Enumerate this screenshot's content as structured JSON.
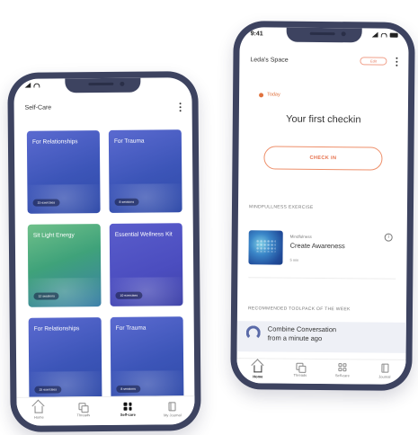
{
  "left_phone": {
    "header": {
      "title": "Self-Care"
    },
    "cards": [
      {
        "title": "For Relationships",
        "badge": "15 exercises",
        "style": "blue"
      },
      {
        "title": "For Trauma",
        "badge": "8 sessions",
        "style": "blue"
      },
      {
        "title": "Sit Light Energy",
        "badge": "12 sessions",
        "style": "green"
      },
      {
        "title": "Essential Wellness Kit",
        "badge": "10 exercises",
        "style": "purple"
      },
      {
        "title": "For Relationships",
        "badge": "15 exercises",
        "style": "blue"
      },
      {
        "title": "For Trauma",
        "badge": "8 sessions",
        "style": "blue"
      }
    ],
    "nav": [
      {
        "label": "Home",
        "icon": "home-icon",
        "active": false
      },
      {
        "label": "Threads",
        "icon": "threads-icon",
        "active": false
      },
      {
        "label": "Self-care",
        "icon": "grid-icon",
        "active": true
      },
      {
        "label": "My Journal",
        "icon": "journal-icon",
        "active": false
      }
    ]
  },
  "right_phone": {
    "status": {
      "time": "9:41"
    },
    "header": {
      "title": "Leda's Space",
      "pill": "Edit"
    },
    "today_label": "Today",
    "checkin_title": "Your first checkin",
    "checkin_button": "CHECK IN",
    "mindfulness": {
      "section_label": "MINDFULLNESS EXERCISE",
      "kicker": "Mindfulness",
      "title": "Create Awareness",
      "meta": "5 min"
    },
    "toolpack": {
      "section_label": "RECOMMENDED TOOLPACK OF THE WEEK",
      "title": "Combine Conversation",
      "subtitle": "from a minute ago"
    },
    "nav": [
      {
        "label": "Home",
        "icon": "home-icon",
        "active": true
      },
      {
        "label": "Threads",
        "icon": "threads-icon",
        "active": false
      },
      {
        "label": "Self-care",
        "icon": "grid-icon",
        "active": false
      },
      {
        "label": "Journal",
        "icon": "journal-icon",
        "active": false
      }
    ]
  },
  "colors": {
    "frame": "#3d4360",
    "accent_orange": "#e56b45",
    "card_blue": "#3c55b8",
    "card_green": "#3fa27a",
    "card_purple": "#4b4dbf"
  }
}
